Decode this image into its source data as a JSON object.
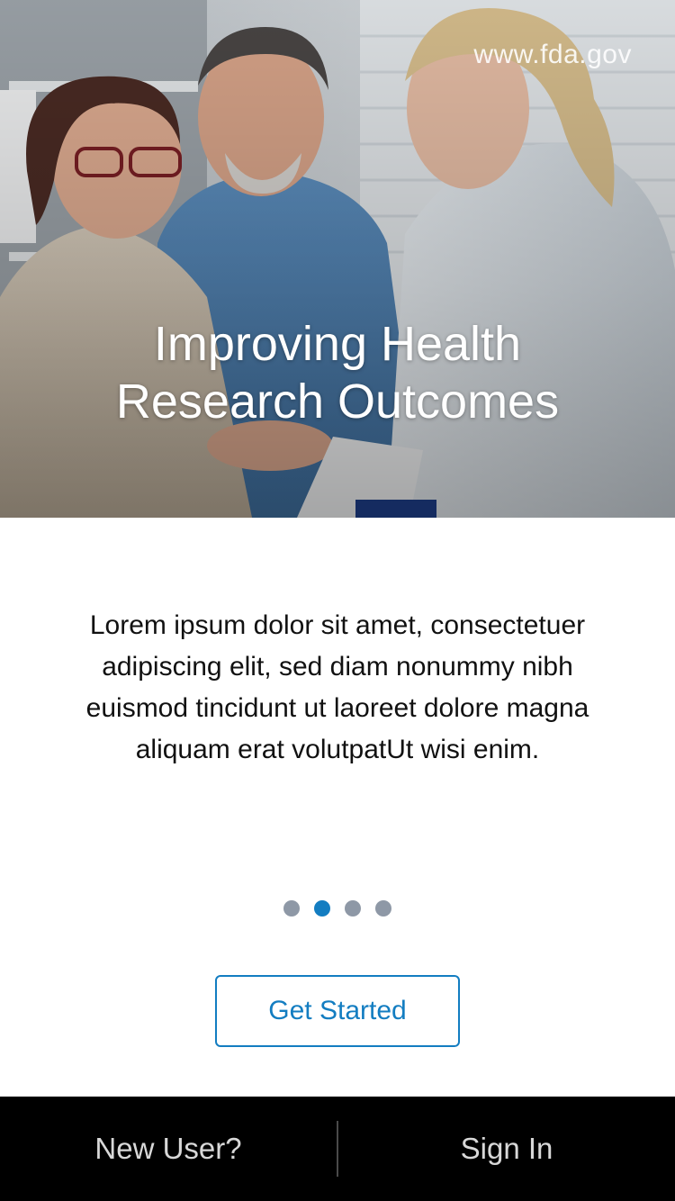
{
  "hero": {
    "url_text": "www.fda.gov",
    "title_line1": "Improving Health",
    "title_line2": "Research Outcomes"
  },
  "intro": {
    "text": "Lorem ipsum dolor sit amet, consectetuer adipiscing elit, sed diam nonummy nibh euismod tincidunt ut laoreet dolore magna aliquam erat volutpatUt wisi enim."
  },
  "pager": {
    "count": 4,
    "active_index": 1
  },
  "actions": {
    "get_started_label": "Get Started"
  },
  "bottom_bar": {
    "new_user_label": "New User?",
    "sign_in_label": "Sign In"
  },
  "colors": {
    "accent": "#137dc1",
    "dot_inactive": "#8e98a6",
    "bottom_bar_bg": "#000000"
  }
}
